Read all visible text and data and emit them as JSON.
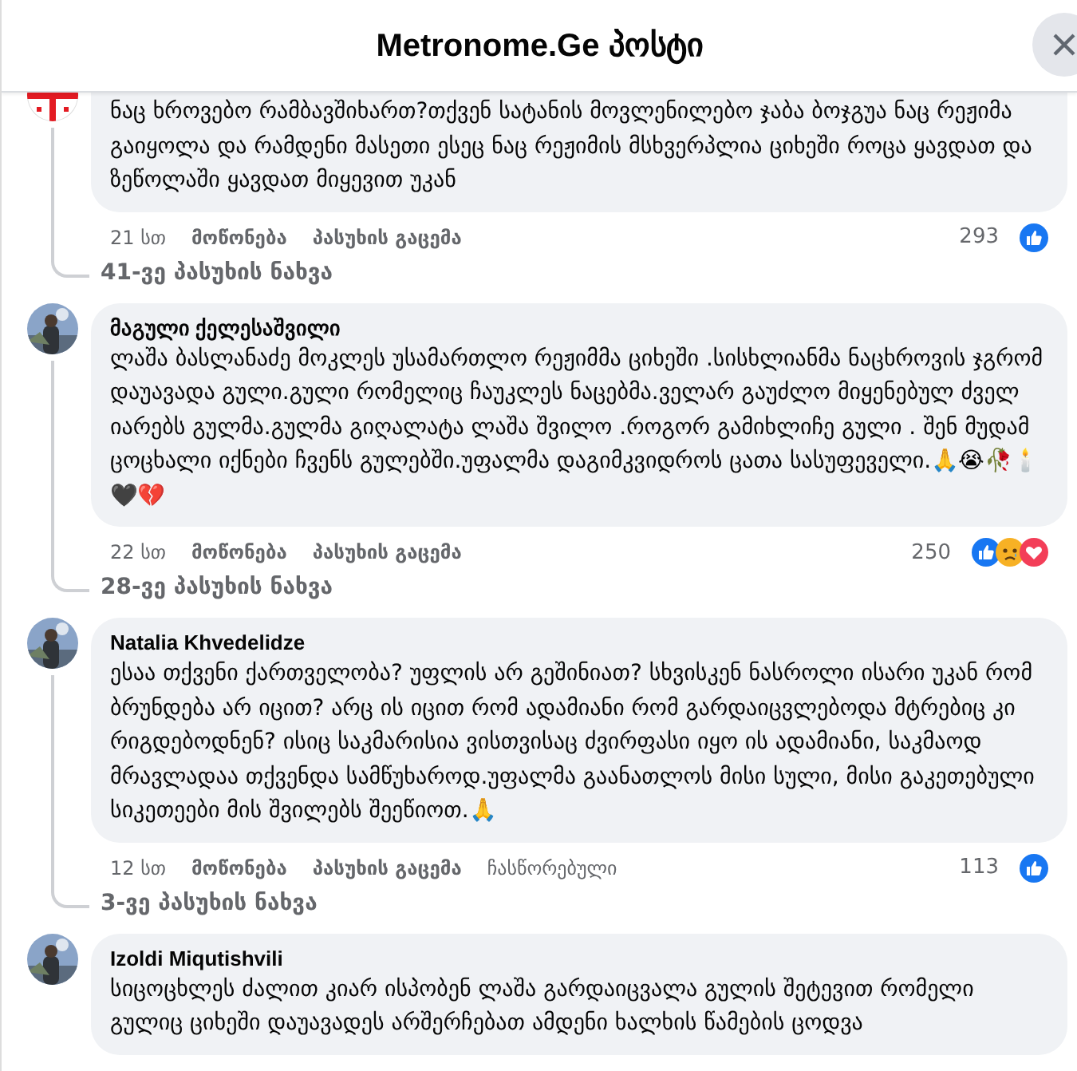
{
  "header": {
    "title": "Metronome.Ge პოსტი"
  },
  "comments": [
    {
      "avatar": {
        "kind": "flag"
      },
      "text": "ნაც ხროვებო რამბავშიხართ?თქვენ სატანის მოვლენილებო ჯაბა ბოჯგუა ნაც რეჟიმა გაიყოლა და რამდენი მასეთი ესეც ნაც რეჟიმის მსხვერპლია ციხეში როცა ყავდათ და ზეწოლაში ყავდათ მიყევით უკან",
      "time": "21 სთ",
      "actions": [
        {
          "label": "მოწონება",
          "kind": "link"
        },
        {
          "label": "პასუხის გაცემა",
          "kind": "link"
        }
      ],
      "count": "293",
      "reactions": [
        {
          "kind": "like"
        }
      ],
      "replies": "41-ვე პასუხის ნახვა"
    },
    {
      "avatar": {
        "kind": "picture"
      },
      "author": "მაგული ქელესაშვილი",
      "text": "ლაშა ბასლანაძე მოკლეს უსამართლო რეჟიმმა ციხეში .სისხლიანმა ნაცხროვის ჯგრომ დაუავადა გული.გული რომელიც ჩაუკლეს ნაცებმა.ველარ გაუძლო მიყენებულ ძველ იარებს გულმა.გულმა გიღალატა ლაშა შვილო .როგორ გამიხლიჩე გული . შენ მუდამ ცოცხალი იქნები ჩვენს გულებში.უფალმა დაგიმკვიდროს ცათა სასუფეველი.🙏😭🥀🕯️🖤💔",
      "time": "22 სთ",
      "actions": [
        {
          "label": "მოწონება",
          "kind": "link"
        },
        {
          "label": "პასუხის გაცემა",
          "kind": "link"
        }
      ],
      "count": "250",
      "reactions": [
        {
          "kind": "like"
        },
        {
          "kind": "sad"
        },
        {
          "kind": "love"
        }
      ],
      "replies": "28-ვე პასუხის ნახვა"
    },
    {
      "avatar": {
        "kind": "picture"
      },
      "author": "Natalia Khvedelidze",
      "text": "ესაა თქვენი ქართველობა? უფლის არ გეშინიათ? სხვისკენ ნასროლი ისარი უკან რომ ბრუნდება არ იცით? არც ის იცით რომ ადამიანი რომ გარდაიცვლებოდა მტრებიც კი რიგდებოდნენ? ისიც საკმარისია ვისთვისაც ძვირფასი იყო ის ადამიანი, საკმაოდ მრავლადაა თქვენდა სამწუხაროდ.უფალმა გაანათლოს მისი სული, მისი გაკეთებული სიკეთეები მის შვილებს შეეწიოთ.🙏",
      "time": "12 სთ",
      "actions": [
        {
          "label": "მოწონება",
          "kind": "link"
        },
        {
          "label": "პასუხის გაცემა",
          "kind": "link"
        },
        {
          "label": "ჩასწორებული",
          "kind": "note"
        }
      ],
      "count": "113",
      "reactions": [
        {
          "kind": "like"
        }
      ],
      "replies": "3-ვე პასუხის ნახვა"
    },
    {
      "avatar": {
        "kind": "picture"
      },
      "author": "Izoldi Miqutishvili",
      "text": "სიცოცხლეს ძალით კიარ ისპობენ ლაშა გარდაიცვალა გულის შეტევით რომელი გულიც ციხეში დაუავადეს არშერჩებათ ამდენი ხალხის წამების ცოდვა"
    }
  ]
}
